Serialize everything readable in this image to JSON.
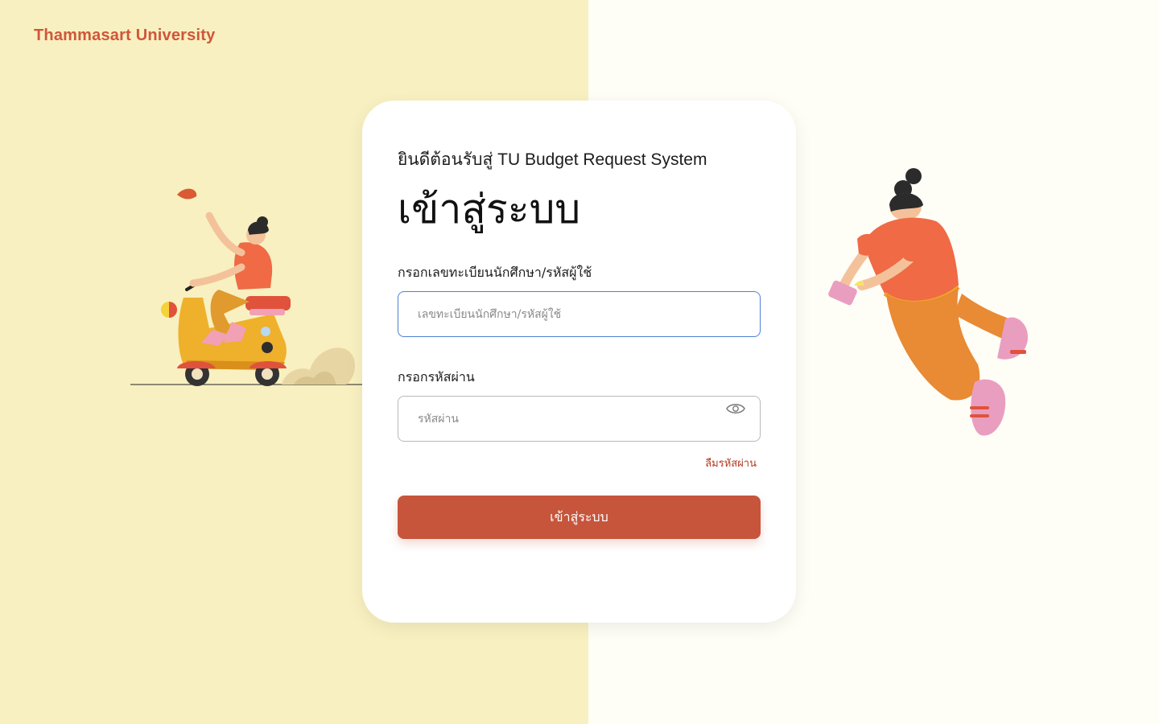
{
  "brand": {
    "name": "Thammasart University"
  },
  "login": {
    "welcome": "ยินดีต้อนรับสู่ TU Budget Request System",
    "title": "เข้าสู่ระบบ",
    "username": {
      "label": "กรอกเลขทะเบียนนักศึกษา/รหัสผู้ใช้",
      "placeholder": "เลขทะเบียนนักศึกษา/รหัสผู้ใช้",
      "value": ""
    },
    "password": {
      "label": "กรอกรหัสผ่าน",
      "placeholder": "รหัสผ่าน",
      "value": "",
      "toggle_icon": "eye-icon"
    },
    "forgot_label": "ลืมรหัสผ่าน",
    "submit_label": "เข้าสู่ระบบ"
  },
  "colors": {
    "left_bg": "#f8f0c0",
    "right_bg": "#fefdf6",
    "brand": "#d0563a",
    "primary_button": "#c6553c",
    "focus_border": "#4f80d6",
    "link": "#b23a22"
  },
  "illustrations": {
    "left": "scooter-rider-illustration",
    "right": "floating-person-with-phone-illustration"
  }
}
